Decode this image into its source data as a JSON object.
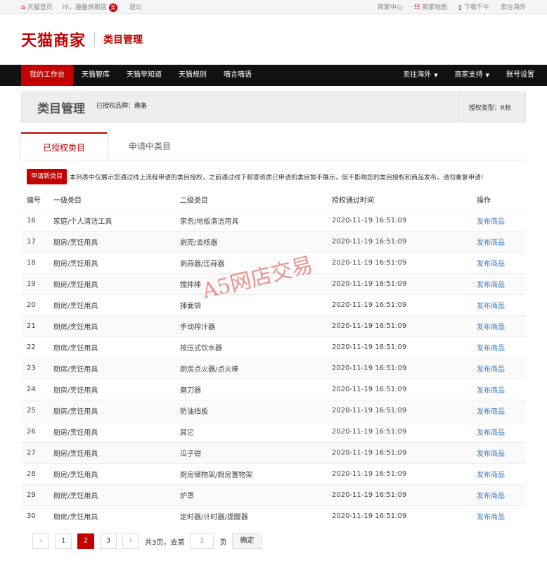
{
  "topbar": {
    "home": "天猫首页",
    "greeting": "Hi，趣备旗舰店",
    "badge": "菜",
    "logout": "退出",
    "merchant_center": "商家中心",
    "sitemap": "商家地图",
    "download": "下载千牛",
    "overseas": "卖往海外"
  },
  "brand": {
    "logo": "天猫商家",
    "subtitle": "类目管理"
  },
  "nav": {
    "items": [
      "我的工作台",
      "天猫智库",
      "天猫早知道",
      "天猫规则",
      "喵言喵语"
    ],
    "right": [
      "卖往海外",
      "商家支持",
      "账号设置"
    ]
  },
  "pagehead": {
    "title": "类目管理",
    "brand_note": "已授权品牌：趣备",
    "auth_type": "授权类型：R标"
  },
  "tabs": [
    "已授权类目",
    "申请中类目"
  ],
  "notice": {
    "button": "申请新类目",
    "text": "本列表中仅展示您通过线上流程申请的类目授权，之前通过线下邮寄资质已申请的类目暂不展示，但不影响您的类目授权和商品发布，请勿重复申请!"
  },
  "table": {
    "headers": [
      "编号",
      "一级类目",
      "二级类目",
      "授权通过时间",
      "操作"
    ],
    "rows": [
      [
        "16",
        "家庭/个人清洁工具",
        "家务/地板清洁用具",
        "2020-11-19 16:51:09",
        "发布商品"
      ],
      [
        "17",
        "厨房/烹饪用具",
        "剥壳/去核器",
        "2020-11-19 16:51:09",
        "发布商品"
      ],
      [
        "18",
        "厨房/烹饪用具",
        "剥蒜器/压蒜器",
        "2020-11-19 16:51:09",
        "发布商品"
      ],
      [
        "19",
        "厨房/烹饪用具",
        "搅拌棒",
        "2020-11-19 16:51:09",
        "发布商品"
      ],
      [
        "20",
        "厨房/烹饪用具",
        "揉面袋",
        "2020-11-19 16:51:09",
        "发布商品"
      ],
      [
        "21",
        "厨房/烹饪用具",
        "手动榨汁器",
        "2020-11-19 16:51:09",
        "发布商品"
      ],
      [
        "22",
        "厨房/烹饪用具",
        "按压式饮水器",
        "2020-11-19 16:51:09",
        "发布商品"
      ],
      [
        "23",
        "厨房/烹饪用具",
        "厨房点火器/点火棒",
        "2020-11-19 16:51:09",
        "发布商品"
      ],
      [
        "24",
        "厨房/烹饪用具",
        "磨刀器",
        "2020-11-19 16:51:09",
        "发布商品"
      ],
      [
        "25",
        "厨房/烹饪用具",
        "防油挡板",
        "2020-11-19 16:51:09",
        "发布商品"
      ],
      [
        "26",
        "厨房/烹饪用具",
        "其它",
        "2020-11-19 16:51:09",
        "发布商品"
      ],
      [
        "27",
        "厨房/烹饪用具",
        "瓜子钳",
        "2020-11-19 16:51:09",
        "发布商品"
      ],
      [
        "28",
        "厨房/烹饪用具",
        "厨房储物架/厨房置物架",
        "2020-11-19 16:51:09",
        "发布商品"
      ],
      [
        "29",
        "厨房/烹饪用具",
        "炉罩",
        "2020-11-19 16:51:09",
        "发布商品"
      ],
      [
        "30",
        "厨房/烹饪用具",
        "定时器/计时器/提醒器",
        "2020-11-19 16:51:09",
        "发布商品"
      ]
    ]
  },
  "pager": {
    "prev": "‹",
    "pages": [
      "1",
      "2",
      "3"
    ],
    "current": "2",
    "next": "›",
    "total_text": "共3页，去第",
    "goto_value": "2",
    "page_unit": "页",
    "confirm": "确定"
  },
  "watermark": "A5网店交易"
}
